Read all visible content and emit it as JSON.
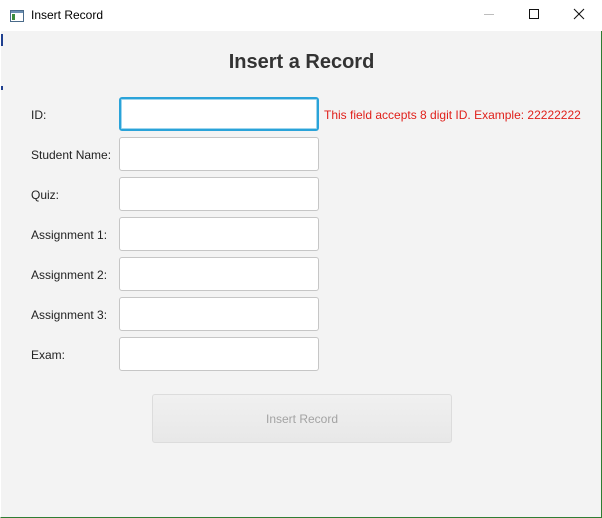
{
  "window": {
    "title": "Insert Record",
    "icons": {
      "app": "window-icon",
      "minimize": "minimize-icon",
      "maximize": "maximize-icon",
      "close": "close-icon"
    }
  },
  "form": {
    "heading": "Insert a Record",
    "fields": [
      {
        "label": "ID:",
        "value": "",
        "placeholder": ""
      },
      {
        "label": "Student Name:",
        "value": "",
        "placeholder": ""
      },
      {
        "label": "Quiz:",
        "value": "",
        "placeholder": ""
      },
      {
        "label": "Assignment 1:",
        "value": "",
        "placeholder": ""
      },
      {
        "label": "Assignment 2:",
        "value": "",
        "placeholder": ""
      },
      {
        "label": "Assignment 3:",
        "value": "",
        "placeholder": ""
      },
      {
        "label": "Exam:",
        "value": "",
        "placeholder": ""
      }
    ],
    "id_hint": "This field accepts 8 digit ID. Example: 22222222",
    "submit_label": "Insert Record",
    "submit_disabled": true
  },
  "colors": {
    "hint": "#e0201b",
    "focus": "#2aa3d9",
    "heading": "#333333"
  }
}
